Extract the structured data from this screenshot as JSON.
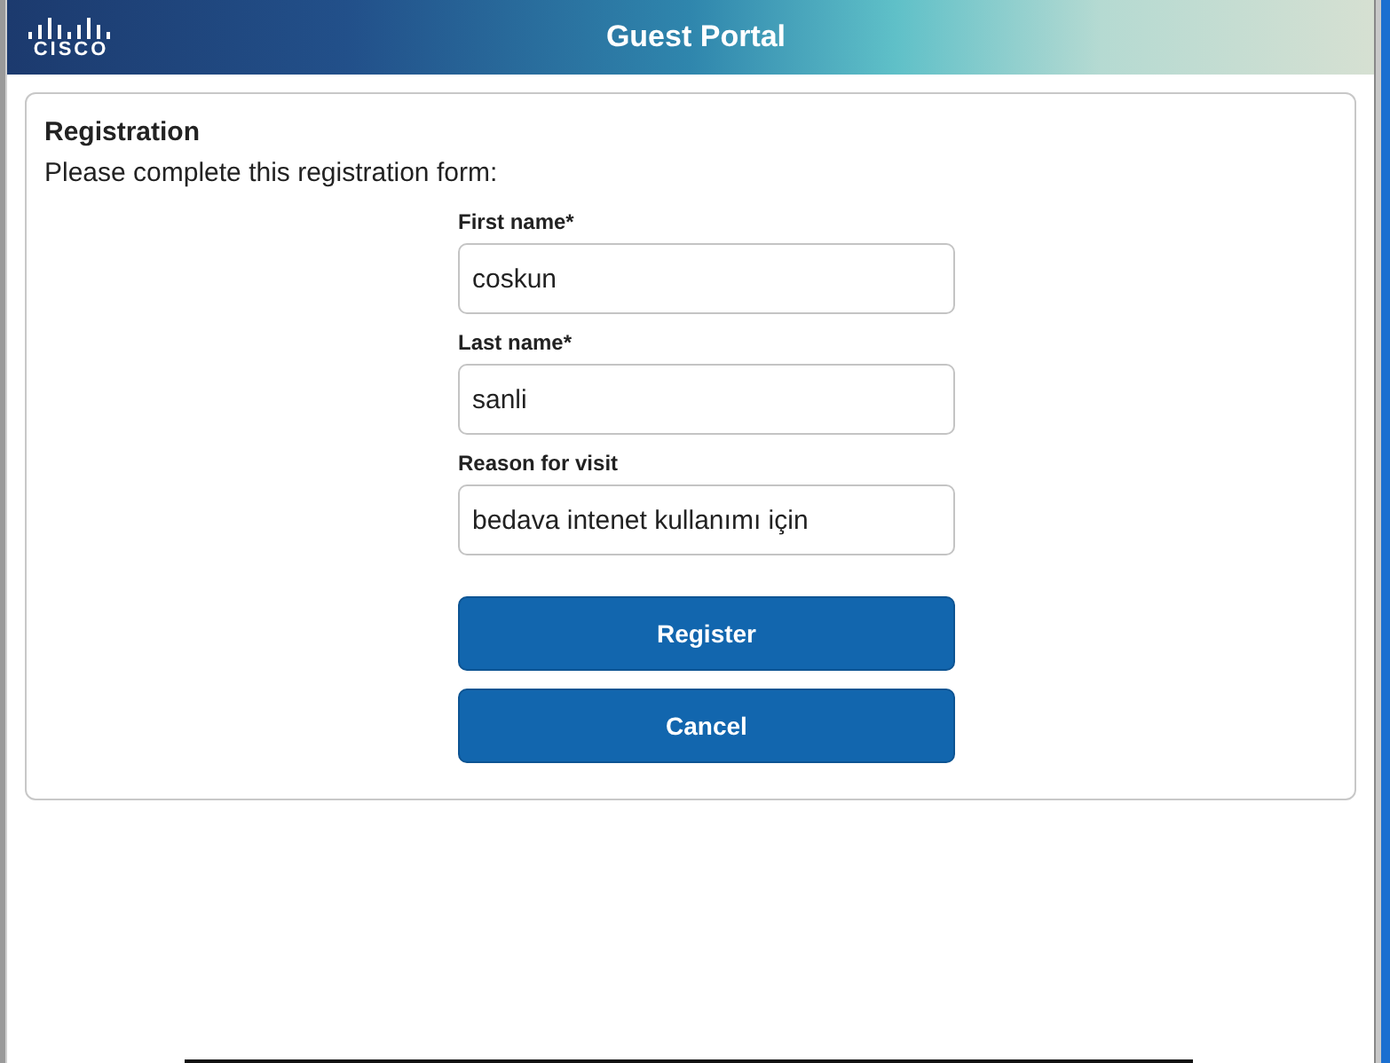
{
  "header": {
    "logo_text": "CISCO",
    "title": "Guest Portal"
  },
  "form": {
    "heading": "Registration",
    "intro": "Please complete this registration form:",
    "fields": [
      {
        "label": "First name*",
        "value": "coskun"
      },
      {
        "label": "Last name*",
        "value": "sanli"
      },
      {
        "label": "Reason for visit",
        "value": "bedava intenet kullanımı için"
      }
    ],
    "buttons": [
      "Register",
      "Cancel"
    ]
  }
}
